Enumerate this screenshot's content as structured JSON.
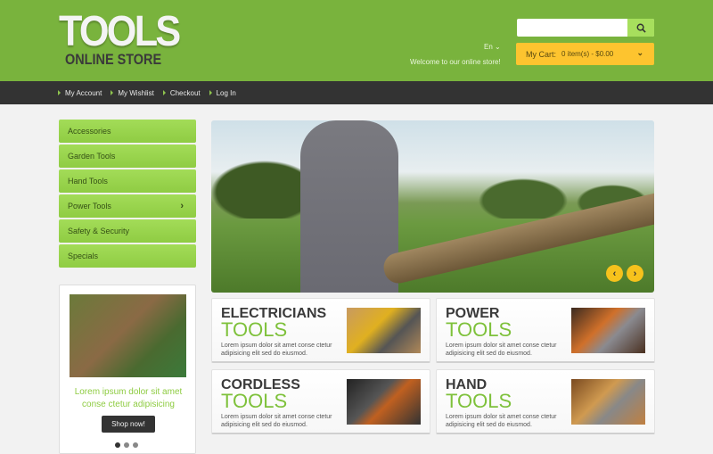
{
  "header": {
    "logo_line1": "TOOLS",
    "logo_line2": "ONLINE STORE",
    "search_placeholder": "",
    "language": "En",
    "welcome": "Welcome to our online store!",
    "cart_label": "My Cart:",
    "cart_summary": "0 item(s) - $0.00",
    "brand_color": "#79b33d",
    "cart_color": "#fdc42f"
  },
  "nav": {
    "items": [
      "My Account",
      "My Wishlist",
      "Checkout",
      "Log In"
    ]
  },
  "sidebar": {
    "items": [
      "Accessories",
      "Garden Tools",
      "Hand Tools",
      "Power Tools",
      "Safety & Security",
      "Specials"
    ]
  },
  "promo": {
    "text": "Lorem ipsum dolor sit amet conse ctetur adipisicing",
    "button": "Shop now!"
  },
  "banners": [
    {
      "title": "ELECTRICIANS",
      "subtitle": "TOOLS",
      "desc": "Lorem ipsum dolor sit amet conse ctetur adipisicing elit sed do eiusmod."
    },
    {
      "title": "POWER",
      "subtitle": "TOOLS",
      "desc": "Lorem ipsum dolor sit amet conse ctetur adipisicing elit sed do eiusmod."
    },
    {
      "title": "CORDLESS",
      "subtitle": "TOOLS",
      "desc": "Lorem ipsum dolor sit amet conse ctetur adipisicing elit sed do eiusmod."
    },
    {
      "title": "HAND",
      "subtitle": "TOOLS",
      "desc": "Lorem ipsum dolor sit amet conse ctetur adipisicing elit sed do eiusmod."
    }
  ]
}
